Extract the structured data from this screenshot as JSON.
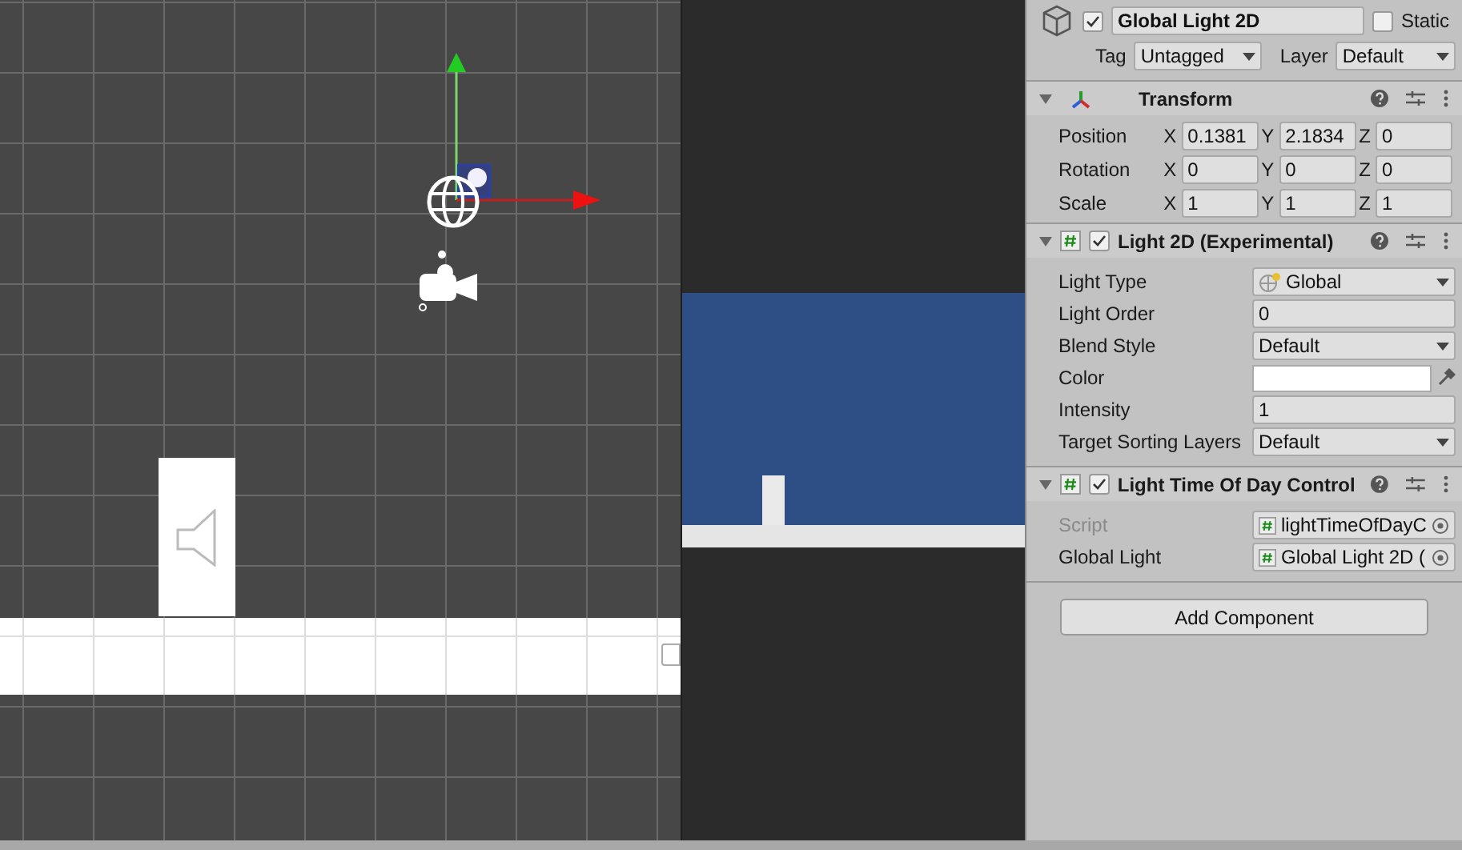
{
  "header": {
    "name": "Global Light 2D",
    "active": true,
    "static_label": "Static",
    "static_checked": false,
    "tag_label": "Tag",
    "tag_value": "Untagged",
    "layer_label": "Layer",
    "layer_value": "Default"
  },
  "components": [
    {
      "kind": "transform",
      "title": "Transform",
      "expanded": true,
      "rows": [
        {
          "label": "Position",
          "fields": [
            {
              "axis": "X",
              "value": "0.1381"
            },
            {
              "axis": "Y",
              "value": "2.1834"
            },
            {
              "axis": "Z",
              "value": "0"
            }
          ]
        },
        {
          "label": "Rotation",
          "fields": [
            {
              "axis": "X",
              "value": "0"
            },
            {
              "axis": "Y",
              "value": "0"
            },
            {
              "axis": "Z",
              "value": "0"
            }
          ]
        },
        {
          "label": "Scale",
          "fields": [
            {
              "axis": "X",
              "value": "1"
            },
            {
              "axis": "Y",
              "value": "1"
            },
            {
              "axis": "Z",
              "value": "1"
            }
          ]
        }
      ]
    },
    {
      "kind": "script",
      "title": "Light 2D (Experimental)",
      "expanded": true,
      "enabled": true,
      "properties": [
        {
          "kind": "dropdown",
          "label": "Light Type",
          "value": "Global",
          "icon": true,
          "disabled": false
        },
        {
          "kind": "text",
          "label": "Light Order",
          "value": "0",
          "disabled": false
        },
        {
          "kind": "dropdown",
          "label": "Blend Style",
          "value": "Default",
          "icon": false,
          "disabled": false
        },
        {
          "kind": "color",
          "label": "Color",
          "color": "#ffffff",
          "disabled": false
        },
        {
          "kind": "text",
          "label": "Intensity",
          "value": "1",
          "disabled": false
        },
        {
          "kind": "dropdown",
          "label": "Target Sorting Layers",
          "value": "Default",
          "icon": false,
          "disabled": false
        }
      ]
    },
    {
      "kind": "script",
      "title": "Light Time Of Day Control",
      "expanded": true,
      "enabled": true,
      "properties": [
        {
          "kind": "object",
          "label": "Script",
          "value": "lightTimeOfDayC",
          "disabled": true
        },
        {
          "kind": "object",
          "label": "Global Light",
          "value": "Global Light 2D (",
          "disabled": false
        }
      ]
    }
  ],
  "add_component_button": "Add Component"
}
